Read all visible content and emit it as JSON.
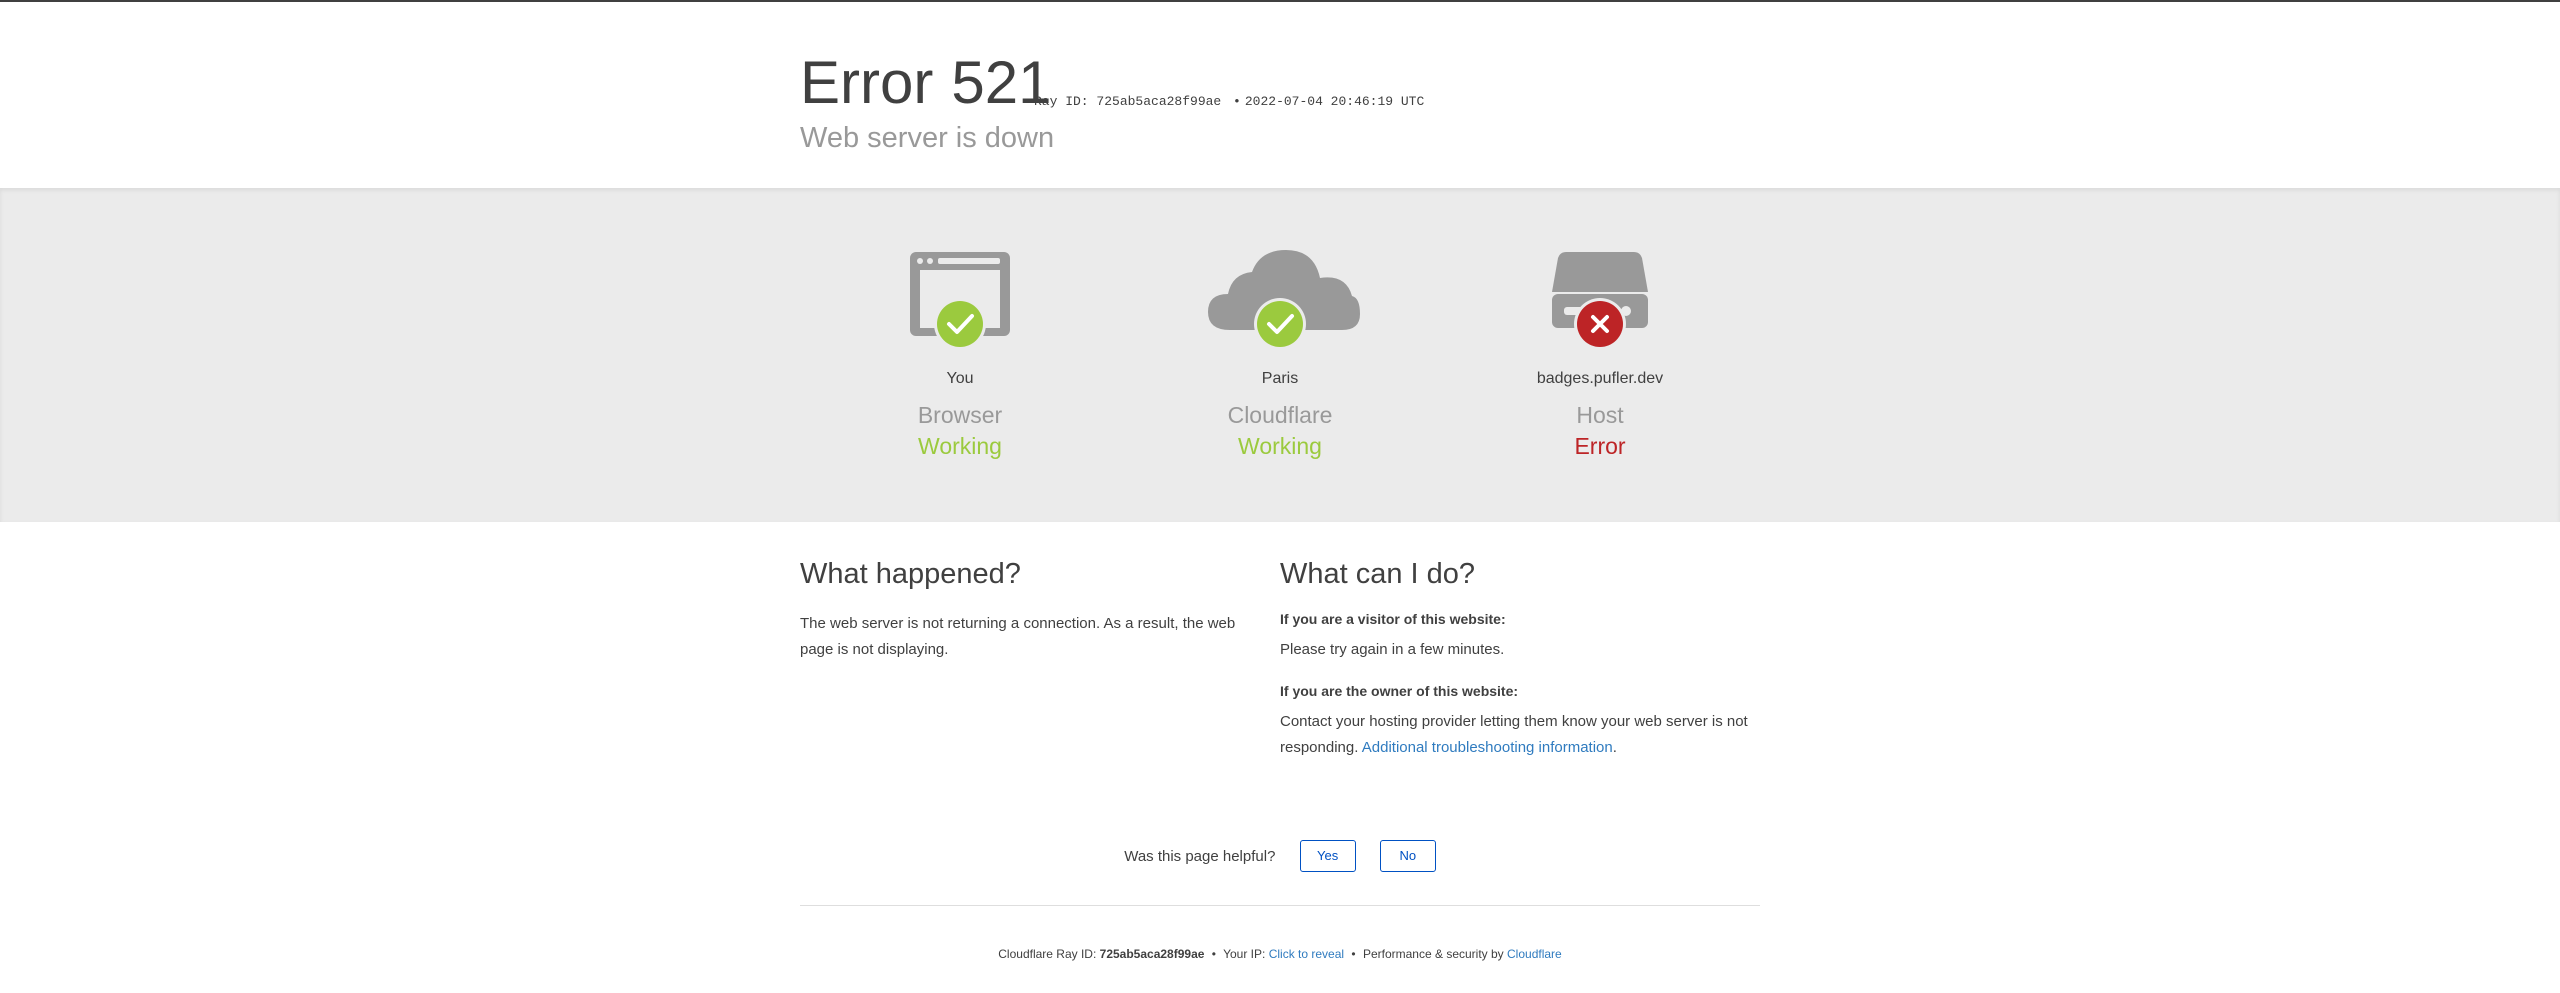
{
  "header": {
    "error_word": "Error",
    "error_code": "521",
    "ray_label": "Ray ID: 725ab5aca28f99ae",
    "separator": "•",
    "timestamp": "2022-07-04 20:46:19 UTC",
    "subtitle": "Web server is down"
  },
  "nodes": [
    {
      "location": "You",
      "role": "Browser",
      "status": "Working",
      "state": "ok",
      "icon": "browser-window-icon"
    },
    {
      "location": "Paris",
      "role": "Cloudflare",
      "status": "Working",
      "state": "ok",
      "icon": "cloud-icon"
    },
    {
      "location": "badges.pufler.dev",
      "role": "Host",
      "status": "Error",
      "state": "error",
      "icon": "server-icon"
    }
  ],
  "colors": {
    "ok": "#9bca3e",
    "error": "#bd2426",
    "icon_gray": "#999999",
    "link": "#2f7bbf",
    "button": "#0051c3"
  },
  "what_happened": {
    "heading": "What happened?",
    "body": "The web server is not returning a connection. As a result, the web page is not displaying."
  },
  "what_can_i_do": {
    "heading": "What can I do?",
    "visitor_heading": "If you are a visitor of this website:",
    "visitor_body": "Please try again in a few minutes.",
    "owner_heading": "If you are the owner of this website:",
    "owner_body": "Contact your hosting provider letting them know your web server is not responding.",
    "owner_link": "Additional troubleshooting information",
    "owner_trailing": "."
  },
  "feedback": {
    "question": "Was this page helpful?",
    "yes_label": "Yes",
    "no_label": "No"
  },
  "footer": {
    "ray_prefix": "Cloudflare Ray ID:",
    "ray_id": "725ab5aca28f99ae",
    "sep1": "•",
    "ip_prefix": "Your IP:",
    "ip_link": "Click to reveal",
    "sep2": "•",
    "perf_text": "Performance & security by",
    "cf_link": "Cloudflare"
  }
}
